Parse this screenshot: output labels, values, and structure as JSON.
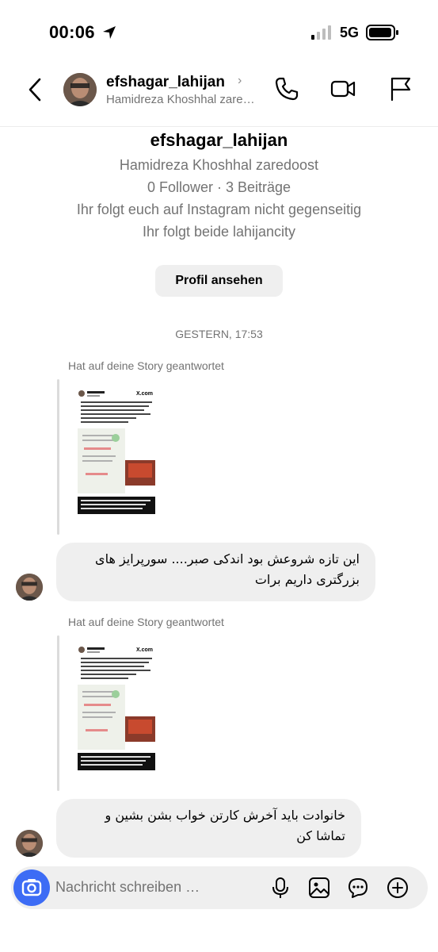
{
  "status_bar": {
    "time": "00:06",
    "network": "5G"
  },
  "header": {
    "username": "efshagar_lahijan",
    "chevron": "›",
    "subtitle": "Hamidreza Khoshhal zaredoost",
    "icons": [
      "back-icon",
      "phone-icon",
      "video-icon",
      "flag-icon"
    ]
  },
  "profile": {
    "username": "efshagar_lahijan",
    "full_name": "Hamidreza Khoshhal zaredoost",
    "stats": "0 Follower · 3 Beiträge",
    "mutual_note": "Ihr folgt euch auf Instagram nicht gegenseitig",
    "common_follow": "Ihr folgt beide lahijancity",
    "view_profile_label": "Profil ansehen"
  },
  "date_separator": "GESTERN, 17:53",
  "messages": [
    {
      "replied_label": "Hat auf deine Story geantwortet",
      "text_line1": "این تازه شروعش بود اندکی صبر.... سورپرایز های",
      "text_line2": "بزرگتری داریم برات"
    },
    {
      "replied_label": "Hat auf deine Story geantwortet",
      "text_line1": "خانوادت باید آخرش کارتن خواب بشن بشین و",
      "text_line2": "تماشا کن"
    }
  ],
  "story_card": {
    "author": "Pouyan Khoshhal",
    "platform": "X.com"
  },
  "composer": {
    "placeholder": "Nachricht schreiben …",
    "icons": [
      "camera-icon",
      "microphone-icon",
      "gallery-icon",
      "sticker-icon",
      "plus-icon"
    ]
  },
  "colors": {
    "accent": "#3d6cf5",
    "bubble": "#efefef",
    "secondary_text": "#737373"
  }
}
